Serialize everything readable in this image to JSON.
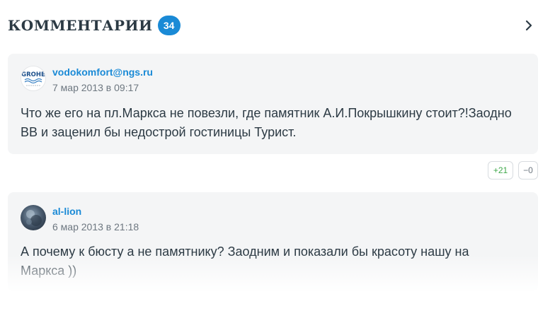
{
  "header": {
    "title": "КОММЕНТАРИИ",
    "count": "34"
  },
  "comments": [
    {
      "avatar_text": "GROHE",
      "author": "vodokomfort@ngs.ru",
      "date": "7 мар 2013 в 09:17",
      "text": "Что же его на пл.Маркса не повезли, где памятник А.И.Покрышкину стоит?!Заодно ВВ и заценил бы недострой гостиницы Турист.",
      "votes_up": "+21",
      "votes_down": "−0"
    },
    {
      "author": "al-lion",
      "date": "6 мар 2013 в 21:18",
      "text": "А почему к бюсту а не памятнику? Заодним и показали бы красоту нашу на Маркса ))"
    }
  ],
  "colors": {
    "accent": "#1a8ad6",
    "text": "#2c3a44",
    "muted": "#6d7780",
    "card_bg": "#f4f5f6",
    "positive": "#3ea84a"
  }
}
